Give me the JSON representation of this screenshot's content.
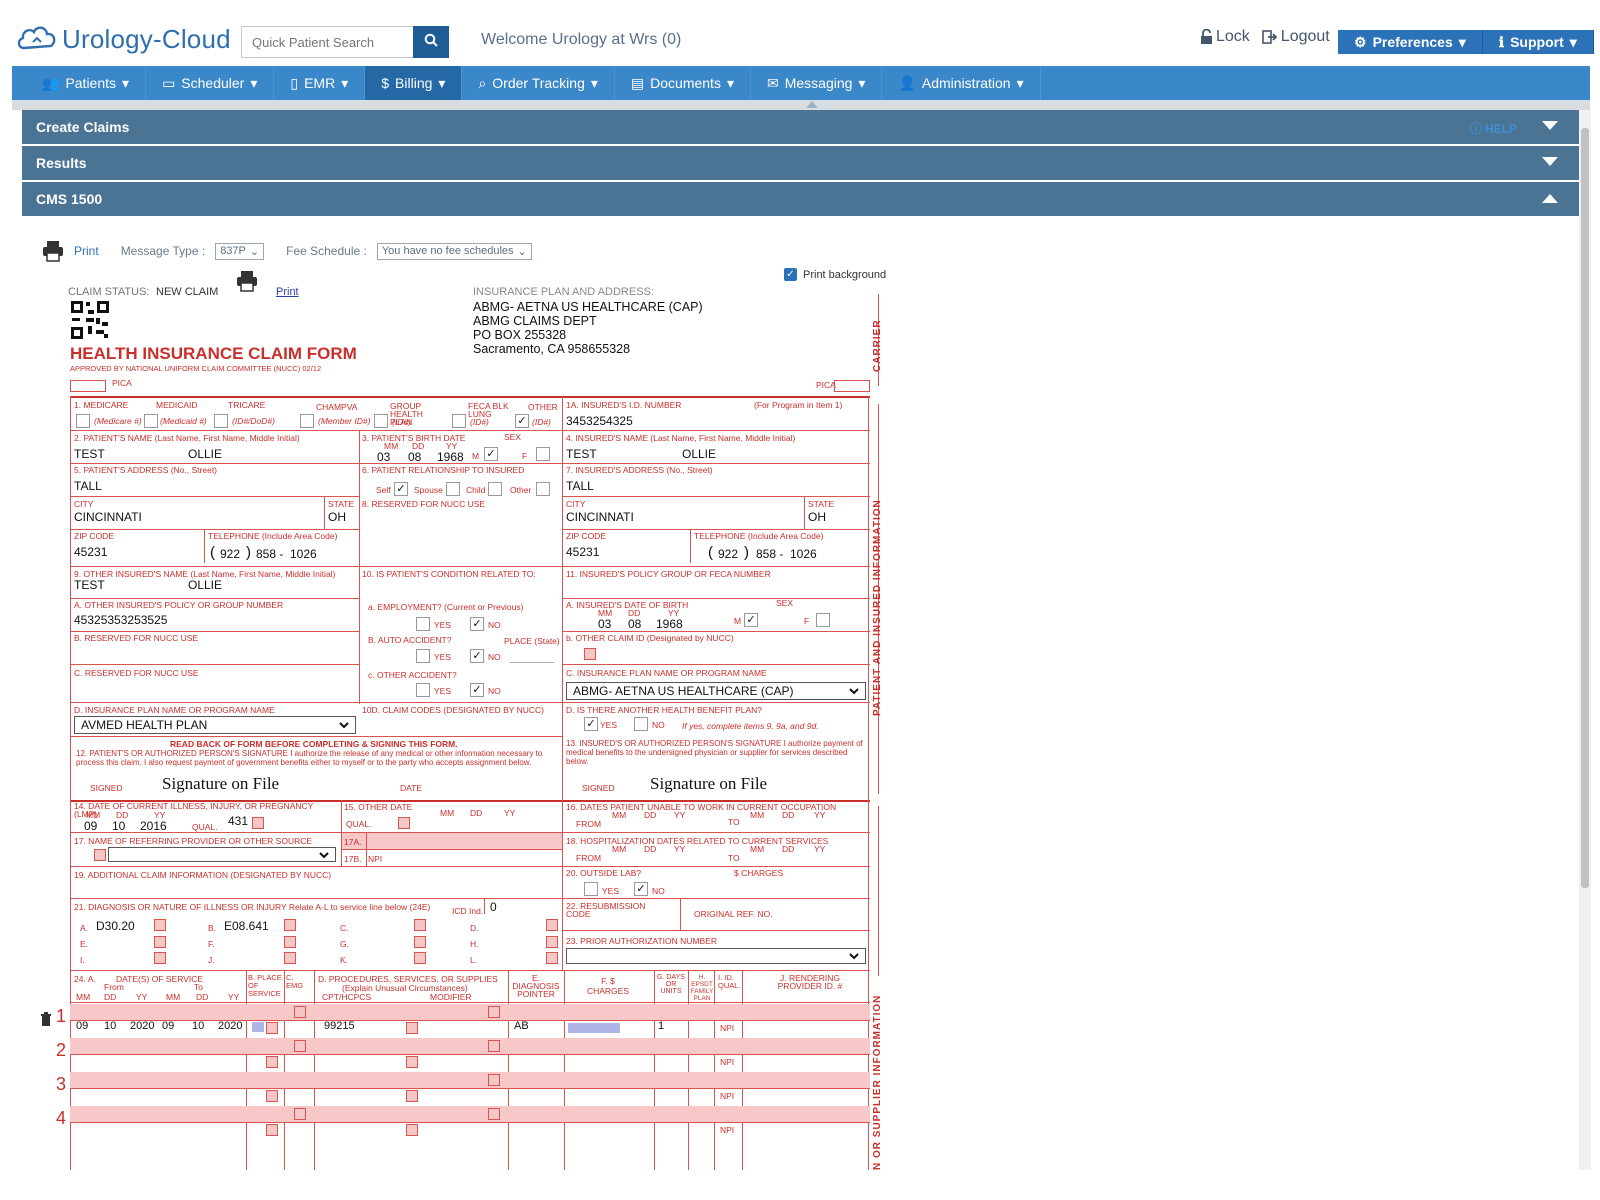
{
  "header": {
    "logo_text": "Urology-Cloud",
    "search_placeholder": "Quick Patient Search",
    "welcome": "Welcome Urology at Wrs (0)",
    "lock": "Lock",
    "logout": "Logout",
    "preferences": "Preferences",
    "support": "Support"
  },
  "nav": {
    "items": [
      {
        "label": "Patients",
        "icon": "users-icon"
      },
      {
        "label": "Scheduler",
        "icon": "calendar-icon"
      },
      {
        "label": "EMR",
        "icon": "file-icon"
      },
      {
        "label": "Billing",
        "icon": "dollar-icon"
      },
      {
        "label": "Order Tracking",
        "icon": "search-icon"
      },
      {
        "label": "Documents",
        "icon": "document-icon"
      },
      {
        "label": "Messaging",
        "icon": "envelope-icon"
      },
      {
        "label": "Administration",
        "icon": "user-icon"
      }
    ]
  },
  "panels": {
    "create_claims": "Create Claims",
    "help": "HELP",
    "results": "Results",
    "cms1500": "CMS 1500"
  },
  "toolbar": {
    "print": "Print",
    "message_type_label": "Message Type :",
    "message_type_value": "837P",
    "fee_schedule_label": "Fee Schedule :",
    "fee_schedule_value": "You have no fee schedules",
    "print_background": "Print background"
  },
  "form": {
    "claim_status_label": "CLAIM STATUS:",
    "claim_status_value": "NEW CLAIM",
    "print_link": "Print",
    "insurance_header": "INSURANCE PLAN AND ADDRESS:",
    "insurance_lines": [
      "ABMG- AETNA US HEALTHCARE (CAP)",
      "ABMG CLAIMS DEPT",
      "PO BOX 255328",
      "Sacramento, CA 958655328"
    ],
    "title": "HEALTH INSURANCE CLAIM FORM",
    "subtitle": "APPROVED BY NATIONAL UNIFORM CLAIM COMMITTEE (NUCC) 02/12",
    "pica": "PICA",
    "carrier": "CARRIER",
    "patient_insured_info": "PATIENT AND INSURED INFORMATION",
    "supplier_info": "N OR SUPPLIER INFORMATION",
    "l1": "1. MEDICARE",
    "l1_medicaid": "MEDICAID",
    "l1_tricare": "TRICARE",
    "l1_champva": "CHAMPVA",
    "l1_group": "GROUP HEALTH PLAN",
    "l1_feca": "FECA BLK LUNG",
    "l1_other": "OTHER",
    "l1_medicare_sub": "(Medicare #)",
    "l1_medicaid_sub": "(Medicaid #)",
    "l1_tricare_sub": "(ID#/DoD#)",
    "l1_champva_sub": "(Member ID#)",
    "l1_group_sub": "(ID#)",
    "l1_feca_sub": "(ID#)",
    "l1_other_sub": "(ID#)",
    "l1a": "1a. INSURED'S I.D. NUMBER",
    "l1a_note": "(For Program in Item 1)",
    "insured_id": "3453254325",
    "l2": "2. PATIENT'S NAME (Last Name, First Name, Middle Initial)",
    "patient_last": "TEST",
    "patient_first": "OLLIE",
    "l3": "3. PATIENT'S BIRTH DATE",
    "l3_sex": "SEX",
    "mm": "MM",
    "dd": "DD",
    "yy": "YY",
    "birth_mm": "03",
    "birth_dd": "08",
    "birth_yy": "1968",
    "m": "M",
    "f": "F",
    "l4": "4. INSURED'S NAME (Last Name, First Name, Middle Initial)",
    "insured_last": "TEST",
    "insured_first": "OLLIE",
    "l5": "5. PATIENT'S ADDRESS (No., Street)",
    "patient_street": "TALL",
    "l6": "6. PATIENT RELATIONSHIP TO INSURED",
    "rel_self": "Self",
    "rel_spouse": "Spouse",
    "rel_child": "Child",
    "rel_other": "Other",
    "l7": "7. INSURED'S ADDRESS (No., Street)",
    "insured_street": "TALL",
    "city_lbl": "CITY",
    "state_lbl": "STATE",
    "city": "CINCINNATI",
    "state": "OH",
    "l8": "8. RESERVED FOR NUCC USE",
    "zip_lbl": "ZIP CODE",
    "tel_lbl": "TELEPHONE (Include Area Code)",
    "zip": "45231",
    "tel_area": "922",
    "tel_prefix": "858 -",
    "tel_line": "1026",
    "l9": "9. OTHER INSURED'S NAME (Last Name, First Name, Middle Initial)",
    "other_last": "TEST",
    "other_first": "OLLIE",
    "l10": "10. IS PATIENT'S CONDITION RELATED TO:",
    "l11": "11. INSURED'S POLICY GROUP OR FECA NUMBER",
    "l9a": "a. OTHER INSURED'S POLICY OR GROUP NUMBER",
    "other_policy": "45325353253525",
    "l10a": "a. EMPLOYMENT? (Current or Previous)",
    "yes": "YES",
    "no": "NO",
    "l11a": "a. INSURED'S DATE OF BIRTH",
    "l9b": "b. RESERVED FOR NUCC USE",
    "l10b": "b. AUTO ACCIDENT?",
    "place_state": "PLACE (State)",
    "l11b": "b. OTHER CLAIM ID (Designated by NUCC)",
    "l9c": "c. RESERVED FOR NUCC USE",
    "l10c": "c. OTHER ACCIDENT?",
    "l11c": "c. INSURANCE PLAN NAME OR PROGRAM NAME",
    "insured_plan": "ABMG- AETNA US HEALTHCARE (CAP)",
    "l9d": "d. INSURANCE PLAN NAME OR PROGRAM NAME",
    "other_plan": "AVMED HEALTH PLAN",
    "l10d": "10d. CLAIM CODES (Designated by NUCC)",
    "l11d": "d. IS THERE ANOTHER HEALTH BENEFIT PLAN?",
    "l11d_note": "If yes, complete items 9, 9a, and 9d.",
    "readback": "READ BACK OF FORM BEFORE COMPLETING & SIGNING THIS FORM.",
    "l12": "12. PATIENT'S OR AUTHORIZED PERSON'S SIGNATURE I authorize the release of any medical or other information necessary to process this claim. I also request payment of government benefits either to myself or to the party who accepts assignment below.",
    "l13": "13. INSURED'S OR AUTHORIZED PERSON'S SIGNATURE I authorize payment of medical benefits to the undersigned physician or supplier for services described below.",
    "signed": "SIGNED",
    "date": "DATE",
    "sig_on_file": "Signature on File",
    "l14": "14. DATE OF CURRENT ILLNESS, INJURY, or PREGNANCY (LMP)",
    "ill_mm": "09",
    "ill_dd": "10",
    "ill_yy": "2016",
    "qual": "QUAL.",
    "qual_val": "431",
    "l15": "15. OTHER DATE",
    "l16": "16. DATES PATIENT UNABLE TO WORK IN CURRENT OCCUPATION",
    "from": "FROM",
    "to": "TO",
    "l17": "17. NAME OF REFERRING PROVIDER OR OTHER SOURCE",
    "l17a": "17a.",
    "l17b": "17b.",
    "npi": "NPI",
    "l18": "18. HOSPITALIZATION DATES RELATED TO CURRENT SERVICES",
    "l19": "19. ADDITIONAL CLAIM INFORMATION (Designated by NUCC)",
    "l20": "20. OUTSIDE LAB?",
    "charges": "$ CHARGES",
    "l21": "21. DIAGNOSIS OR NATURE OF ILLNESS OR INJURY  Relate A-L to service line below (24E)",
    "icd_ind": "ICD Ind.",
    "icd_val": "0",
    "diag_a": "D30.20",
    "diag_b": "E08.641",
    "diag_letters": [
      "A.",
      "B.",
      "C.",
      "D.",
      "E.",
      "F.",
      "G.",
      "H.",
      "I.",
      "J.",
      "K.",
      "L."
    ],
    "l22": "22. RESUBMISSION CODE",
    "orig_ref": "ORIGINAL REF. NO.",
    "l23": "23. PRIOR AUTHORIZATION NUMBER",
    "l24a": "24. A.",
    "l24a_dates": "DATE(S) OF SERVICE",
    "from_small": "From",
    "to_small": "To",
    "l24b": "B. PLACE OF SERVICE",
    "l24c": "C. EMG",
    "l24d": "D. PROCEDURES, SERVICES, OR SUPPLIES",
    "l24d_sub": "(Explain Unusual Circumstances)",
    "cpt": "CPT/HCPCS",
    "modifier": "MODIFIER",
    "l24e": "E. DIAGNOSIS POINTER",
    "l24f": "F. $ CHARGES",
    "l24g": "G. DAYS OR UNITS",
    "l24h": "H. EPSDT Family Plan",
    "l24i": "I. ID. QUAL.",
    "l24j": "J. RENDERING PROVIDER ID. #",
    "lines": [
      {
        "num": "1",
        "from_mm": "09",
        "from_dd": "10",
        "from_yy": "2020",
        "to_mm": "09",
        "to_dd": "10",
        "to_yy": "2020",
        "cpt": "99215",
        "pointer": "AB",
        "units": "1",
        "qual": "NPI"
      },
      {
        "num": "2",
        "from_mm": "",
        "from_dd": "",
        "from_yy": "",
        "to_mm": "",
        "to_dd": "",
        "to_yy": "",
        "cpt": "",
        "pointer": "",
        "units": "",
        "qual": "NPI"
      },
      {
        "num": "3",
        "from_mm": "",
        "from_dd": "",
        "from_yy": "",
        "to_mm": "",
        "to_dd": "",
        "to_yy": "",
        "cpt": "",
        "pointer": "",
        "units": "",
        "qual": "NPI"
      },
      {
        "num": "4",
        "from_mm": "",
        "from_dd": "",
        "from_yy": "",
        "to_mm": "",
        "to_dd": "",
        "to_yy": "",
        "cpt": "",
        "pointer": "",
        "units": "",
        "qual": "NPI"
      }
    ]
  },
  "colors": {
    "nav": "#3a87c9",
    "panel": "#4b7494",
    "form_red": "#c9302c",
    "pink": "#f8c7c7"
  }
}
